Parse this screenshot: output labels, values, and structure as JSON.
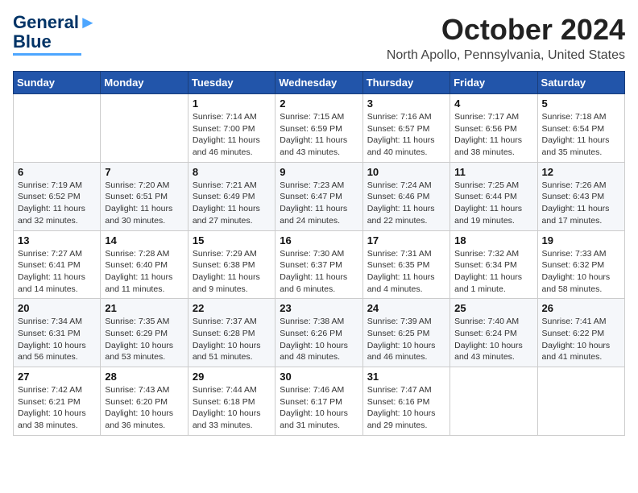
{
  "logo": {
    "line1": "General",
    "line2": "Blue"
  },
  "header": {
    "month": "October 2024",
    "location": "North Apollo, Pennsylvania, United States"
  },
  "weekdays": [
    "Sunday",
    "Monday",
    "Tuesday",
    "Wednesday",
    "Thursday",
    "Friday",
    "Saturday"
  ],
  "weeks": [
    [
      {
        "day": "",
        "sunrise": "",
        "sunset": "",
        "daylight": ""
      },
      {
        "day": "",
        "sunrise": "",
        "sunset": "",
        "daylight": ""
      },
      {
        "day": "1",
        "sunrise": "Sunrise: 7:14 AM",
        "sunset": "Sunset: 7:00 PM",
        "daylight": "Daylight: 11 hours and 46 minutes."
      },
      {
        "day": "2",
        "sunrise": "Sunrise: 7:15 AM",
        "sunset": "Sunset: 6:59 PM",
        "daylight": "Daylight: 11 hours and 43 minutes."
      },
      {
        "day": "3",
        "sunrise": "Sunrise: 7:16 AM",
        "sunset": "Sunset: 6:57 PM",
        "daylight": "Daylight: 11 hours and 40 minutes."
      },
      {
        "day": "4",
        "sunrise": "Sunrise: 7:17 AM",
        "sunset": "Sunset: 6:56 PM",
        "daylight": "Daylight: 11 hours and 38 minutes."
      },
      {
        "day": "5",
        "sunrise": "Sunrise: 7:18 AM",
        "sunset": "Sunset: 6:54 PM",
        "daylight": "Daylight: 11 hours and 35 minutes."
      }
    ],
    [
      {
        "day": "6",
        "sunrise": "Sunrise: 7:19 AM",
        "sunset": "Sunset: 6:52 PM",
        "daylight": "Daylight: 11 hours and 32 minutes."
      },
      {
        "day": "7",
        "sunrise": "Sunrise: 7:20 AM",
        "sunset": "Sunset: 6:51 PM",
        "daylight": "Daylight: 11 hours and 30 minutes."
      },
      {
        "day": "8",
        "sunrise": "Sunrise: 7:21 AM",
        "sunset": "Sunset: 6:49 PM",
        "daylight": "Daylight: 11 hours and 27 minutes."
      },
      {
        "day": "9",
        "sunrise": "Sunrise: 7:23 AM",
        "sunset": "Sunset: 6:47 PM",
        "daylight": "Daylight: 11 hours and 24 minutes."
      },
      {
        "day": "10",
        "sunrise": "Sunrise: 7:24 AM",
        "sunset": "Sunset: 6:46 PM",
        "daylight": "Daylight: 11 hours and 22 minutes."
      },
      {
        "day": "11",
        "sunrise": "Sunrise: 7:25 AM",
        "sunset": "Sunset: 6:44 PM",
        "daylight": "Daylight: 11 hours and 19 minutes."
      },
      {
        "day": "12",
        "sunrise": "Sunrise: 7:26 AM",
        "sunset": "Sunset: 6:43 PM",
        "daylight": "Daylight: 11 hours and 17 minutes."
      }
    ],
    [
      {
        "day": "13",
        "sunrise": "Sunrise: 7:27 AM",
        "sunset": "Sunset: 6:41 PM",
        "daylight": "Daylight: 11 hours and 14 minutes."
      },
      {
        "day": "14",
        "sunrise": "Sunrise: 7:28 AM",
        "sunset": "Sunset: 6:40 PM",
        "daylight": "Daylight: 11 hours and 11 minutes."
      },
      {
        "day": "15",
        "sunrise": "Sunrise: 7:29 AM",
        "sunset": "Sunset: 6:38 PM",
        "daylight": "Daylight: 11 hours and 9 minutes."
      },
      {
        "day": "16",
        "sunrise": "Sunrise: 7:30 AM",
        "sunset": "Sunset: 6:37 PM",
        "daylight": "Daylight: 11 hours and 6 minutes."
      },
      {
        "day": "17",
        "sunrise": "Sunrise: 7:31 AM",
        "sunset": "Sunset: 6:35 PM",
        "daylight": "Daylight: 11 hours and 4 minutes."
      },
      {
        "day": "18",
        "sunrise": "Sunrise: 7:32 AM",
        "sunset": "Sunset: 6:34 PM",
        "daylight": "Daylight: 11 hours and 1 minute."
      },
      {
        "day": "19",
        "sunrise": "Sunrise: 7:33 AM",
        "sunset": "Sunset: 6:32 PM",
        "daylight": "Daylight: 10 hours and 58 minutes."
      }
    ],
    [
      {
        "day": "20",
        "sunrise": "Sunrise: 7:34 AM",
        "sunset": "Sunset: 6:31 PM",
        "daylight": "Daylight: 10 hours and 56 minutes."
      },
      {
        "day": "21",
        "sunrise": "Sunrise: 7:35 AM",
        "sunset": "Sunset: 6:29 PM",
        "daylight": "Daylight: 10 hours and 53 minutes."
      },
      {
        "day": "22",
        "sunrise": "Sunrise: 7:37 AM",
        "sunset": "Sunset: 6:28 PM",
        "daylight": "Daylight: 10 hours and 51 minutes."
      },
      {
        "day": "23",
        "sunrise": "Sunrise: 7:38 AM",
        "sunset": "Sunset: 6:26 PM",
        "daylight": "Daylight: 10 hours and 48 minutes."
      },
      {
        "day": "24",
        "sunrise": "Sunrise: 7:39 AM",
        "sunset": "Sunset: 6:25 PM",
        "daylight": "Daylight: 10 hours and 46 minutes."
      },
      {
        "day": "25",
        "sunrise": "Sunrise: 7:40 AM",
        "sunset": "Sunset: 6:24 PM",
        "daylight": "Daylight: 10 hours and 43 minutes."
      },
      {
        "day": "26",
        "sunrise": "Sunrise: 7:41 AM",
        "sunset": "Sunset: 6:22 PM",
        "daylight": "Daylight: 10 hours and 41 minutes."
      }
    ],
    [
      {
        "day": "27",
        "sunrise": "Sunrise: 7:42 AM",
        "sunset": "Sunset: 6:21 PM",
        "daylight": "Daylight: 10 hours and 38 minutes."
      },
      {
        "day": "28",
        "sunrise": "Sunrise: 7:43 AM",
        "sunset": "Sunset: 6:20 PM",
        "daylight": "Daylight: 10 hours and 36 minutes."
      },
      {
        "day": "29",
        "sunrise": "Sunrise: 7:44 AM",
        "sunset": "Sunset: 6:18 PM",
        "daylight": "Daylight: 10 hours and 33 minutes."
      },
      {
        "day": "30",
        "sunrise": "Sunrise: 7:46 AM",
        "sunset": "Sunset: 6:17 PM",
        "daylight": "Daylight: 10 hours and 31 minutes."
      },
      {
        "day": "31",
        "sunrise": "Sunrise: 7:47 AM",
        "sunset": "Sunset: 6:16 PM",
        "daylight": "Daylight: 10 hours and 29 minutes."
      },
      {
        "day": "",
        "sunrise": "",
        "sunset": "",
        "daylight": ""
      },
      {
        "day": "",
        "sunrise": "",
        "sunset": "",
        "daylight": ""
      }
    ]
  ]
}
